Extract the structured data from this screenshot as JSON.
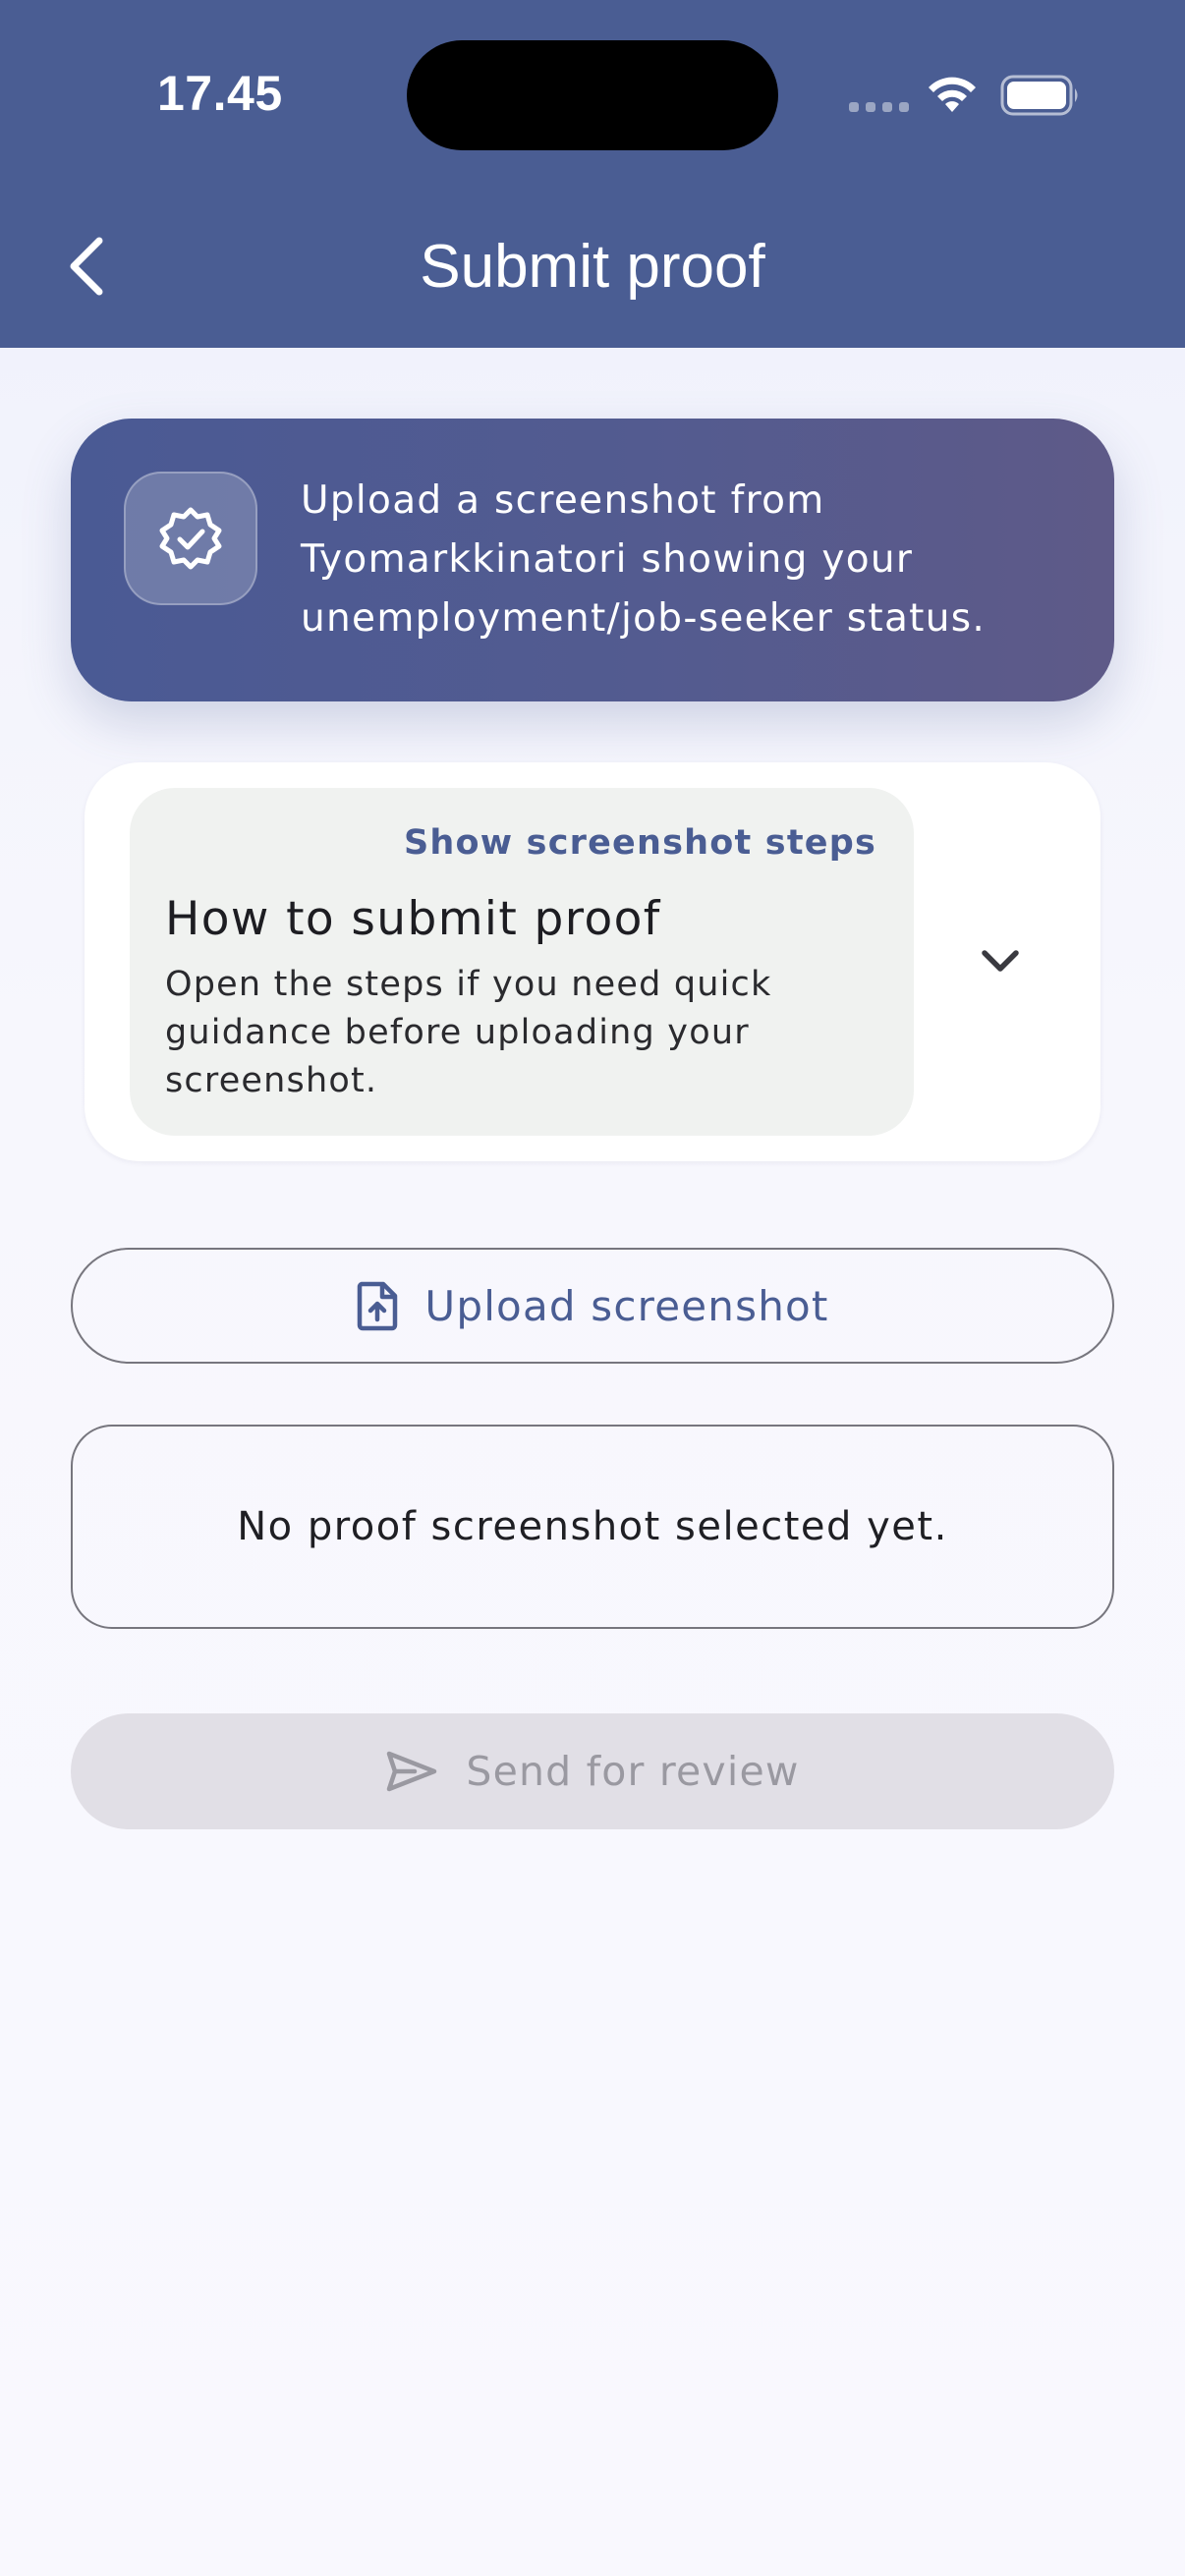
{
  "status_bar": {
    "time": "17.45"
  },
  "header": {
    "title": "Submit proof",
    "back_icon": "chevron-left-icon",
    "background_color": "#4a5d93"
  },
  "info_banner": {
    "icon": "verified-badge-icon",
    "text": "Upload a screenshot from Tyomarkkinatori showing your unemployment/job-seeker status."
  },
  "steps_panel": {
    "toggle_label": "Show screenshot steps",
    "title": "How to submit proof",
    "description": "Open the steps if you need quick guidance before uploading your screenshot.",
    "icon": "chevron-down-icon",
    "expanded": false
  },
  "upload_button": {
    "label": "Upload screenshot",
    "icon": "file-upload-icon"
  },
  "selection": {
    "empty_text": "No proof screenshot selected yet."
  },
  "send_button": {
    "label": "Send for review",
    "icon": "send-icon",
    "enabled": false
  },
  "colors": {
    "accent": "#4a5d93",
    "disabled_bg": "#e1dfe6",
    "disabled_text": "#9a99a1"
  }
}
